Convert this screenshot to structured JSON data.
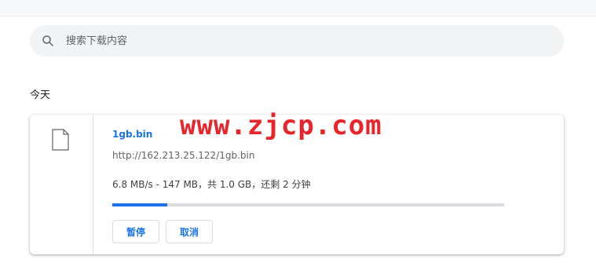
{
  "search": {
    "placeholder": "搜索下载内容",
    "value": "",
    "icon": "search-icon"
  },
  "section": {
    "heading": "今天"
  },
  "download": {
    "icon": "file-icon",
    "file_name": "1gb.bin",
    "url": "http://162.213.25.122/1gb.bin",
    "status": "6.8 MB/s - 147 MB，共 1.0 GB，还剩 2 分钟",
    "progress": 0.14,
    "accent_color": "#1a73e8",
    "buttons": {
      "pause_label": "暂停",
      "cancel_label": "取消"
    }
  },
  "watermark": {
    "text": "www.zjcp.com",
    "color": "#e8252b"
  }
}
